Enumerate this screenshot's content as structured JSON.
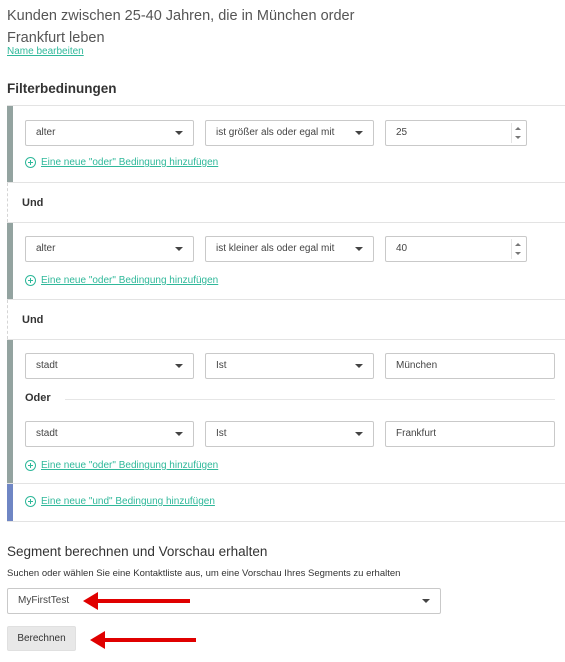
{
  "segment": {
    "name": "Kunden zwischen 25-40 Jahren, die in München order Frankfurt leben",
    "edit_label": "Name bearbeiten"
  },
  "filter_section": {
    "title": "Filterbedinungen",
    "add_or_label": "Eine neue \"oder\" Bedingung hinzufügen",
    "add_and_label": "Eine neue \"und\" Bedingung hinzufügen",
    "and_label": "Und",
    "or_label": "Oder"
  },
  "conditions": [
    {
      "field": "alter",
      "operator": "ist größer als oder egal mit",
      "value": "25"
    },
    {
      "field": "alter",
      "operator": "ist kleiner als oder egal mit",
      "value": "40"
    },
    {
      "field": "stadt",
      "operator": "Ist",
      "value": "München"
    },
    {
      "field": "stadt",
      "operator": "Ist",
      "value": "Frankfurt"
    }
  ],
  "preview": {
    "title": "Segment berechnen und Vorschau erhalten",
    "help": "Suchen oder wählen Sie eine Kontaktliste aus, um eine Vorschau Ihres Segments zu erhalten",
    "selected_list": "MyFirstTest",
    "compute_label": "Berechnen"
  },
  "colors": {
    "accent": "#2fb89a",
    "group_bar": "#93a3a0",
    "and_bar": "#6f86c4",
    "annotation_arrow": "#e00000"
  }
}
